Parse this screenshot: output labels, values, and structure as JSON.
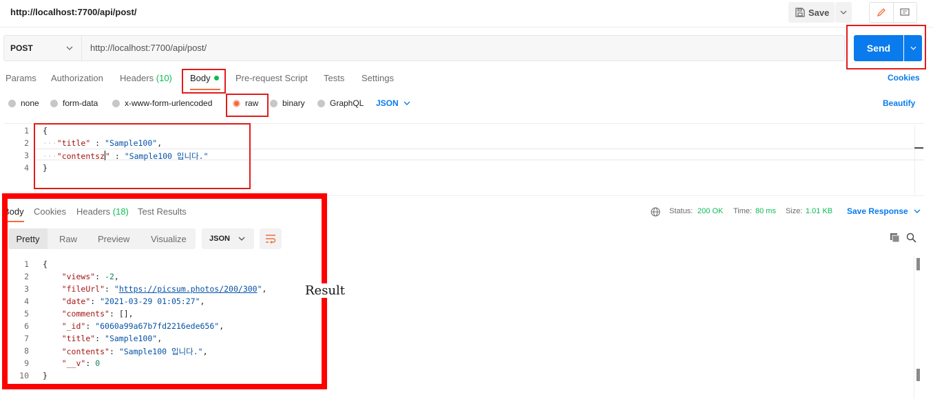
{
  "header": {
    "title": "http://localhost:7700/api/post/",
    "save_label": "Save"
  },
  "url_bar": {
    "method": "POST",
    "url": "http://localhost:7700/api/post/",
    "send_label": "Send"
  },
  "request_tabs": {
    "params": "Params",
    "authorization": "Authorization",
    "headers": "Headers",
    "headers_count": "(10)",
    "body": "Body",
    "pre_request": "Pre-request Script",
    "tests": "Tests",
    "settings": "Settings",
    "cookies": "Cookies"
  },
  "body_types": {
    "none": "none",
    "form_data": "form-data",
    "urlencoded": "x-www-form-urlencoded",
    "raw": "raw",
    "binary": "binary",
    "graphql": "GraphQL",
    "format": "JSON",
    "beautify": "Beautify",
    "selected": "raw"
  },
  "request_body": {
    "lines": [
      "1",
      "2",
      "3",
      "4"
    ],
    "open": "{",
    "l2_key": "\"title\"",
    "l2_sep": " : ",
    "l2_val": "\"Sample100\"",
    "l2_end": ",",
    "l3_key_a": "\"contentsz",
    "l3_key_b": "\"",
    "l3_sep": " : ",
    "l3_val": "\"Sample100 입니다.\"",
    "close": "}"
  },
  "response_tabs": {
    "body": "Body",
    "cookies": "Cookies",
    "headers": "Headers",
    "headers_count": "(18)",
    "test_results": "Test Results"
  },
  "response_status": {
    "status_label": "Status:",
    "status_value": "200 OK",
    "time_label": "Time:",
    "time_value": "80 ms",
    "size_label": "Size:",
    "size_value": "1.01 KB",
    "save_response": "Save Response"
  },
  "response_view": {
    "pretty": "Pretty",
    "raw": "Raw",
    "preview": "Preview",
    "visualize": "Visualize",
    "format": "JSON"
  },
  "response_body": {
    "lines": [
      "1",
      "2",
      "3",
      "4",
      "5",
      "6",
      "7",
      "8",
      "9",
      "10"
    ],
    "open": "{",
    "views_key": "\"views\"",
    "views_val": "-2",
    "fileurl_key": "\"fileUrl\"",
    "fileurl_val": "https://picsum.photos/200/300",
    "date_key": "\"date\"",
    "date_val": "\"2021-03-29 01:05:27\"",
    "comments_key": "\"comments\"",
    "comments_val": "[]",
    "id_key": "\"_id\"",
    "id_val": "\"6060a99a67b7fd2216ede656\"",
    "title_key": "\"title\"",
    "title_val": "\"Sample100\"",
    "contents_key": "\"contents\"",
    "contents_val": "\"Sample100 입니다.\"",
    "v_key": "\"__v\"",
    "v_val": "0",
    "close": "}"
  },
  "annotation": {
    "result_label": "Result"
  },
  "colors": {
    "accent": "#097bed",
    "active_tab": "#f26b3a",
    "success": "#0cbb52",
    "annotation": "#ff0000"
  }
}
